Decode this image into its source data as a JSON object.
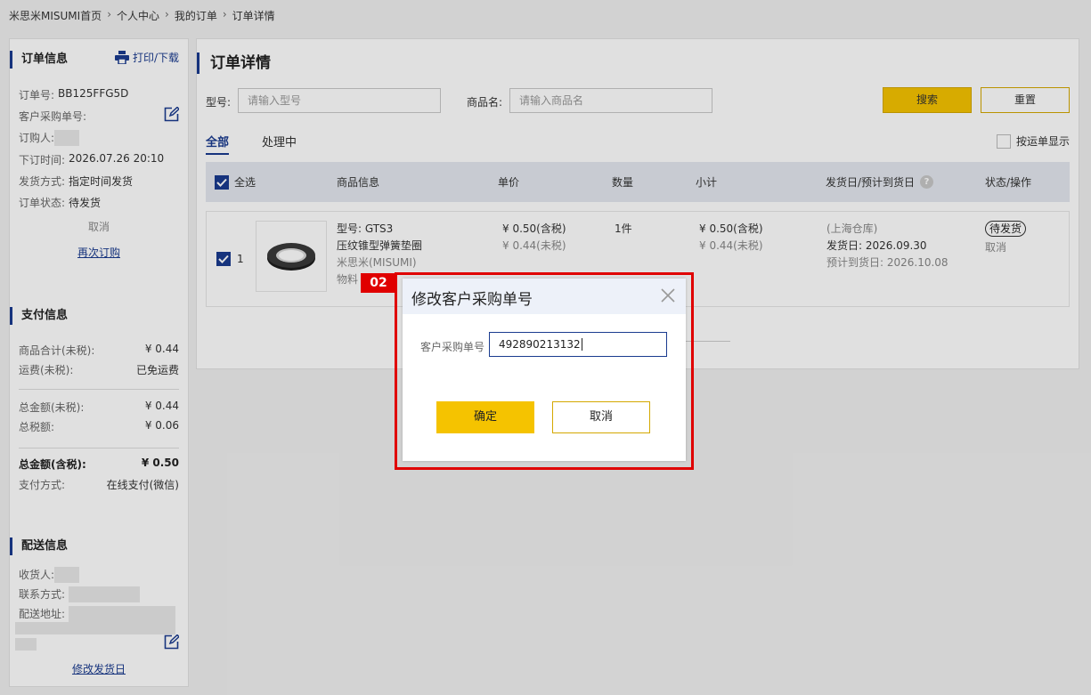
{
  "breadcrumb": [
    "米思米MISUMI首页",
    "个人中心",
    "我的订单",
    "订单详情"
  ],
  "order_info": {
    "title": "订单信息",
    "print_label": "打印/下载",
    "order_no_label": "订单号:",
    "order_no": "BB125FFG5D",
    "customer_po_label": "客户采购单号:",
    "buyer_label": "订购人:",
    "order_time_label": "下订时间:",
    "order_time": "2026.07.26 20:10",
    "ship_method_label": "发货方式:",
    "ship_method": "指定时间发货",
    "status_label": "订单状态:",
    "status": "待发货",
    "cancel": "取消",
    "reorder": "再次订购"
  },
  "payment": {
    "title": "支付信息",
    "goods_total_label": "商品合计(未税):",
    "goods_total": "¥ 0.44",
    "shipping_label": "运费(未税):",
    "shipping": "已免运费",
    "total_pretax_label": "总金额(未税):",
    "total_pretax": "¥ 0.44",
    "tax_label": "总税额:",
    "tax": "¥ 0.06",
    "total_label": "总金额(含税):",
    "total": "¥ 0.50",
    "method_label": "支付方式:",
    "method": "在线支付(微信)"
  },
  "delivery": {
    "title": "配送信息",
    "receiver_label": "收货人:",
    "contact_label": "联系方式:",
    "address_label": "配送地址:",
    "modify_date": "修改发货日"
  },
  "main": {
    "title": "订单详情",
    "model_label": "型号:",
    "model_placeholder": "请输入型号",
    "name_label": "商品名:",
    "name_placeholder": "请输入商品名",
    "search": "搜索",
    "reset": "重置",
    "tabs": [
      "全部",
      "处理中"
    ],
    "waybill": "按运单显示",
    "columns": [
      "全选",
      "商品信息",
      "单价",
      "数量",
      "小计",
      "发货日/预计到货日",
      "状态/操作"
    ],
    "row": {
      "index": "1",
      "model": "型号: GTS3",
      "name": "压纹锥型弹簧垫圈",
      "brand": "米思米(MISUMI)",
      "material": "物料",
      "price_tax": "¥ 0.50(含税)",
      "price_notax": "¥ 0.44(未税)",
      "qty": "1件",
      "subtotal_tax": "¥ 0.50(含税)",
      "subtotal_notax": "¥ 0.44(未税)",
      "warehouse": "(上海仓库)",
      "ship_date": "发货日: 2026.09.30",
      "arrival": "预计到货日: 2026.10.08",
      "status": "待发货",
      "cancel": "取消"
    }
  },
  "modal": {
    "step": "02",
    "title": "修改客户采购单号",
    "label": "客户采购单号",
    "value": "492890213132",
    "ok": "确定",
    "cancel": "取消"
  },
  "colors": {
    "accent": "#1a3b8f",
    "button_yellow": "#f5c300",
    "highlight_red": "#e00000"
  }
}
